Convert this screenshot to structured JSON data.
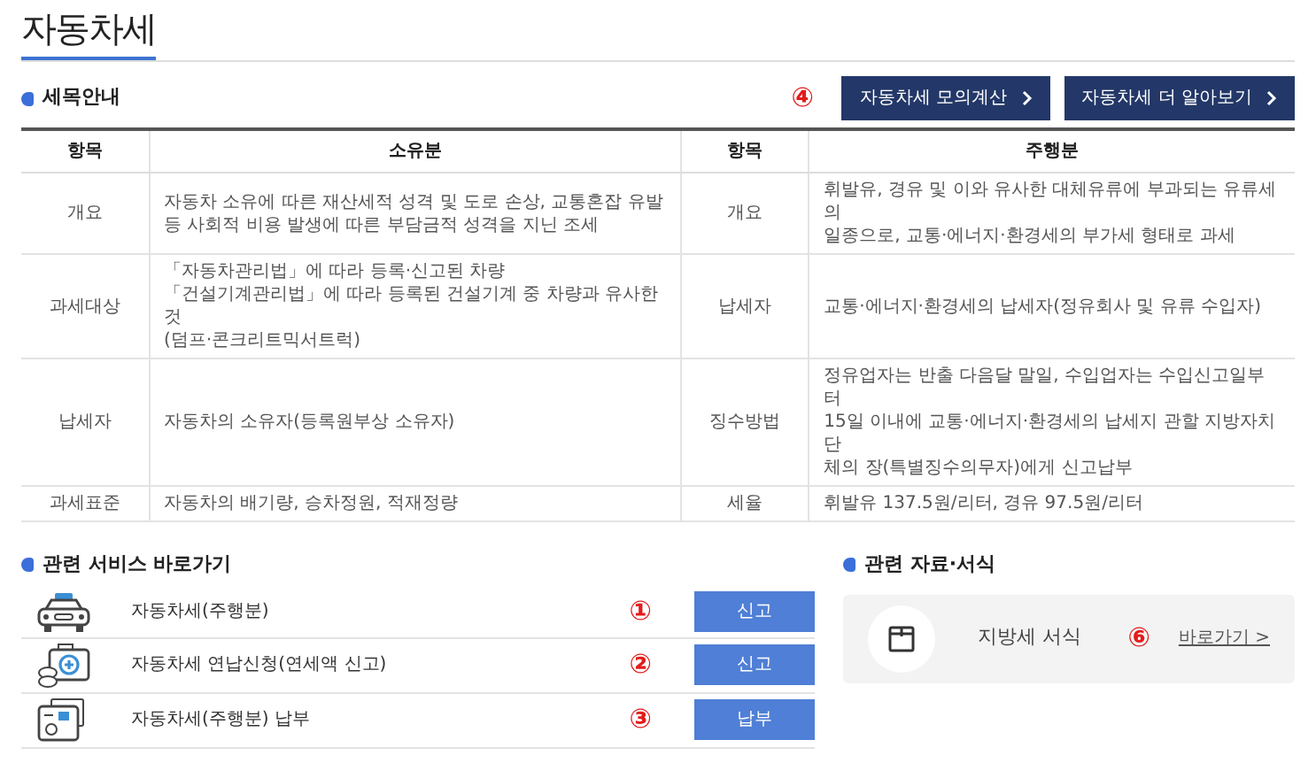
{
  "page_title": "자동차세",
  "tax_info": {
    "heading": "세목안내",
    "marker": "④",
    "buttons": [
      "자동차세 모의계산",
      "자동차세 더 알아보기"
    ],
    "table": {
      "columns": [
        "항목",
        "소유분",
        "항목",
        "주행분"
      ],
      "rows": [
        [
          "개요",
          "자동차 소유에 따른 재산세적 성격 및 도로 손상, 교통혼잡 유발\n등 사회적 비용 발생에 따른 부담금적 성격을 지닌 조세",
          "개요",
          "휘발유, 경유 및 이와 유사한 대체유류에 부과되는 유류세의\n일종으로, 교통·에너지·환경세의 부가세 형태로 과세"
        ],
        [
          "과세대상",
          "「자동차관리법」에 따라 등록·신고된 차량\n「건설기계관리법」에 따라 등록된 건설기계 중 차량과 유사한 것\n(덤프·콘크리트믹서트럭)",
          "납세자",
          "교통·에너지·환경세의 납세자(정유회사 및 유류 수입자)"
        ],
        [
          "납세자",
          "자동차의 소유자(등록원부상 소유자)",
          "징수방법",
          "정유업자는 반출 다음달 말일, 수입업자는 수입신고일부터\n15일 이내에 교통·에너지·환경세의 납세지 관할 지방자치단\n체의 장(특별징수의무자)에게 신고납부"
        ],
        [
          "과세표준",
          "자동차의 배기량, 승차정원, 적재정량",
          "세율",
          "휘발유 137.5원/리터, 경유 97.5원/리터"
        ]
      ]
    }
  },
  "services": {
    "heading": "관련 서비스 바로가기",
    "items": [
      {
        "kind": "taxi",
        "title": "자동차세(주행분)",
        "marker": "①",
        "button": "신고"
      },
      {
        "kind": "medical-kit",
        "title": "자동차세 연납신청(연세액 신고)",
        "marker": "②",
        "button": "신고"
      },
      {
        "kind": "card-terminal",
        "title": "자동차세(주행분) 납부",
        "marker": "③",
        "button": "납부"
      }
    ]
  },
  "resources": {
    "heading": "관련 자료·서식",
    "items": [
      {
        "kind": "document",
        "title": "지방세 서식",
        "marker": "⑥",
        "link": "바로가기 >"
      }
    ]
  }
}
